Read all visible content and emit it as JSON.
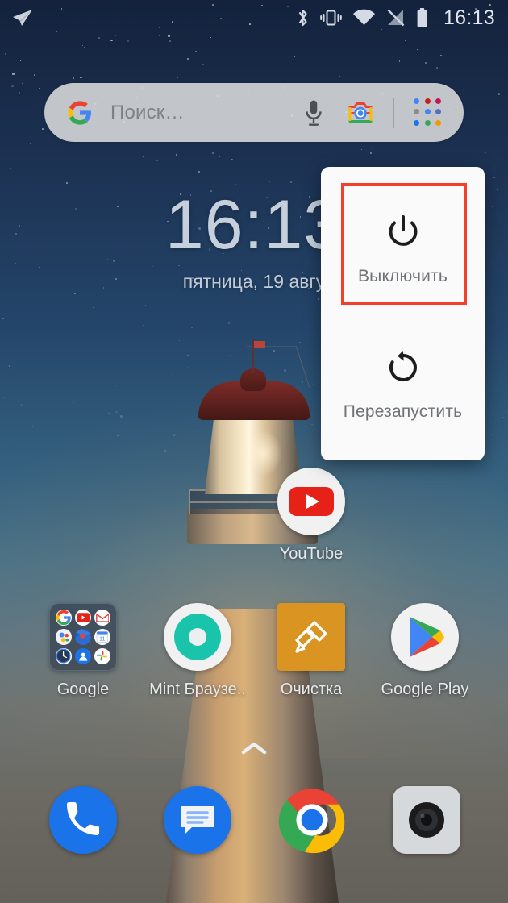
{
  "status_bar": {
    "notification_icon": "telegram-icon",
    "icons": [
      "bluetooth-icon",
      "vibrate-icon",
      "wifi-icon",
      "signal-off-icon",
      "battery-full-icon"
    ],
    "time": "16:13"
  },
  "search": {
    "placeholder": "Поиск…",
    "logo_icon": "google-g-icon",
    "mic_icon": "microphone-icon",
    "lens_icon": "google-lens-icon",
    "grid_icon": "app-grid-icon"
  },
  "clock_widget": {
    "time": "16:13",
    "date": "пятница, 19 авгу"
  },
  "home_apps": [
    {
      "label": "YouTube",
      "icon": "youtube-icon"
    },
    {
      "label": "Google",
      "icon": "google-folder-icon"
    },
    {
      "label": "Mint Браузе..",
      "icon": "mint-browser-icon"
    },
    {
      "label": "Очистка",
      "icon": "cleaner-brush-icon"
    },
    {
      "label": "Google Play",
      "icon": "google-play-icon"
    }
  ],
  "folder_contents": [
    "google-icon",
    "youtube-icon",
    "gmail-icon",
    "assistant-icon",
    "maps-icon",
    "calendar-icon",
    "clock-icon",
    "contacts-icon",
    "photos-icon"
  ],
  "drawer": {
    "handle_icon": "chevron-up-icon"
  },
  "dock": [
    {
      "label": "Phone",
      "icon": "phone-icon"
    },
    {
      "label": "Messages",
      "icon": "messages-icon"
    },
    {
      "label": "Chrome",
      "icon": "chrome-icon"
    },
    {
      "label": "Camera",
      "icon": "camera-icon"
    }
  ],
  "power_dialog": {
    "items": [
      {
        "label": "Выключить",
        "icon": "power-icon"
      },
      {
        "label": "Перезапустить",
        "icon": "restart-icon"
      }
    ]
  },
  "annotation": {
    "highlight_color": "#f3402a",
    "target": "Выключить"
  }
}
